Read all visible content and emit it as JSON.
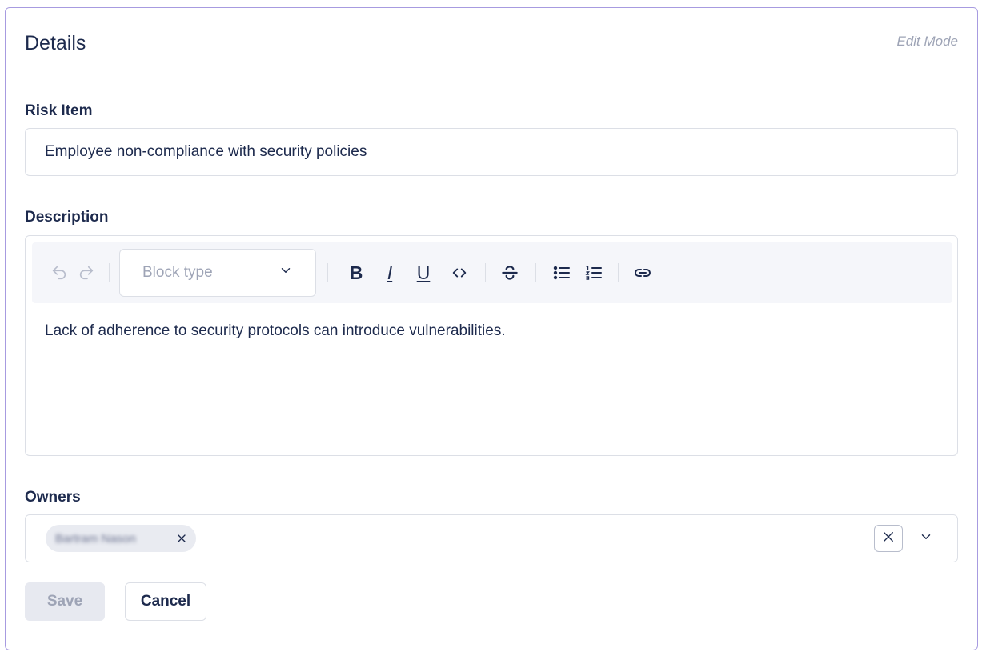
{
  "header": {
    "title": "Details",
    "mode": "Edit Mode"
  },
  "risk_item": {
    "label": "Risk Item",
    "value": "Employee non-compliance with security policies"
  },
  "description": {
    "label": "Description",
    "block_type_placeholder": "Block type",
    "content": "Lack of adherence to security protocols can introduce vulnerabilities.",
    "toolbar_icons": [
      "undo-icon",
      "redo-icon",
      "chevron-down-icon",
      "bold-icon",
      "italic-icon",
      "underline-icon",
      "code-icon",
      "strikethrough-icon",
      "bullet-list-icon",
      "numbered-list-icon",
      "link-icon"
    ],
    "bold_glyph": "B",
    "italic_glyph": "I",
    "underline_glyph": "U"
  },
  "owners": {
    "label": "Owners",
    "selected": [
      {
        "name": "Bartram Nason"
      }
    ]
  },
  "actions": {
    "save_label": "Save",
    "cancel_label": "Cancel"
  },
  "colors": {
    "border_accent": "#a79be0",
    "text_primary": "#1d2a4d",
    "text_muted": "#9ea4b6",
    "toolbar_bg": "#f5f6fa",
    "chip_bg": "#e9ebf1",
    "disabled_bg": "#e7e9f0"
  }
}
